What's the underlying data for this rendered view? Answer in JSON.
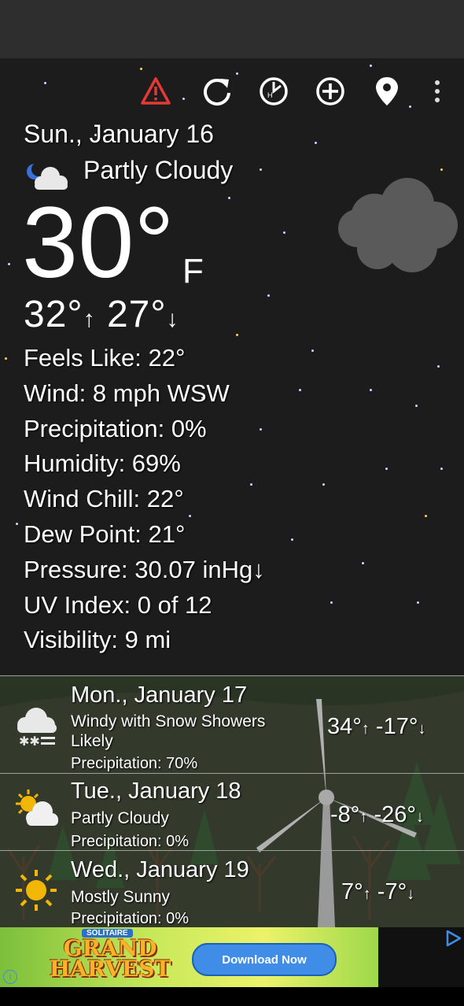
{
  "current": {
    "date": "Sun., January 16",
    "condition": "Partly Cloudy",
    "temperature": "30°",
    "unit": "F",
    "high": "32°",
    "low": "27°",
    "details": [
      "Feels Like: 22°",
      "Wind: 8 mph WSW",
      "Precipitation: 0%",
      "Humidity: 69%",
      "Wind Chill: 22°",
      "Dew Point: 21°",
      "Pressure: 30.07 inHg↓",
      "UV Index: 0 of 12",
      "Visibility: 9 mi"
    ]
  },
  "toolbar": {
    "icons": [
      "alert-icon",
      "refresh-icon",
      "hourly-clock-icon",
      "add-location-icon",
      "location-pin-icon",
      "more-vert-icon"
    ],
    "alert_color": "#e53935"
  },
  "forecast": [
    {
      "date": "Mon., January 17",
      "desc": "Windy with Snow Showers Likely",
      "precip": "Precipitation: 70%",
      "high": "34°",
      "low": "-17°",
      "icon": "snow-cloud-icon"
    },
    {
      "date": "Tue., January 18",
      "desc": "Partly Cloudy",
      "precip": "Precipitation: 0%",
      "high": "-8°",
      "low": "-26°",
      "icon": "partly-sunny-icon"
    },
    {
      "date": "Wed., January 19",
      "desc": "Mostly Sunny",
      "precip": "Precipitation: 0%",
      "high": "7°",
      "low": "-7°",
      "icon": "sun-icon"
    }
  ],
  "ad": {
    "kicker": "SOLITAIRE",
    "title": "GRAND HARVEST",
    "button": "Download Now",
    "info": "i"
  }
}
